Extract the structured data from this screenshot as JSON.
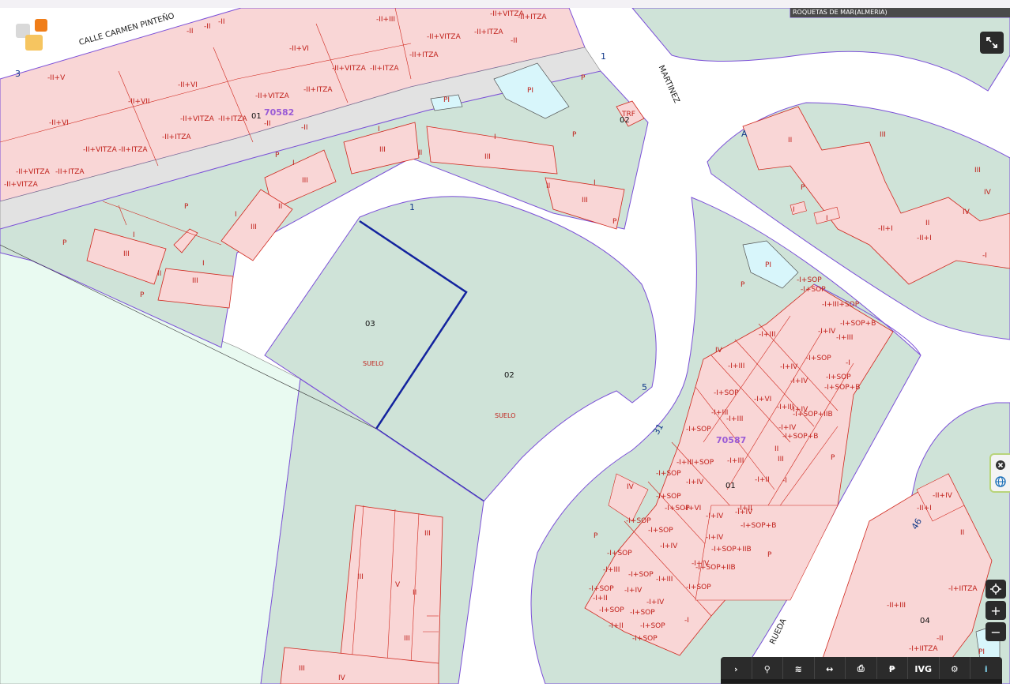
{
  "header": {
    "region_label": "ROQUETAS DE MAR(ALMERIA)"
  },
  "colors": {
    "built_fill": "#f9d6d6",
    "built_stroke": "#d0261c",
    "green_fill": "#cfe3d8",
    "street_fill": "#ffffff",
    "block_border": "#7b4fd8",
    "selected_parcel": "#13239e",
    "pool_fill": "#d8f6fb",
    "sidewalk_fill": "#e2e2e2",
    "pale_green": "#e9faf1"
  },
  "streets": {
    "carmen_pinteno": "CALLE CARMEN PINTEÑO",
    "martinez": "MARTINEZ",
    "rueda": "RUEDA"
  },
  "blocks": {
    "north": "70582",
    "east": "70587"
  },
  "plots": {
    "p03": {
      "number": "03",
      "use": "SUELO"
    },
    "p02": {
      "number": "02",
      "use": "SUELO"
    },
    "north_01": "01",
    "north_02": "02",
    "east_01": "01",
    "east_04": "04"
  },
  "labels": {
    "trf": "TRF",
    "pool": "PI",
    "patio": "P",
    "floor_I": "I",
    "floor_II": "II",
    "floor_III": "III",
    "floor_IV": "IV",
    "floor_V": "V",
    "f_mii": "-II",
    "f_miii": "-II+III",
    "f_miiv": "-II+V",
    "f_mivi": "-II+VI",
    "f_mivii": "-II+VII",
    "f_itza": "-II+ITZA",
    "f_ivitza": "-II+VITZA",
    "f_sop": "-I+SOP",
    "f_iiisop": "-I+III+SOP",
    "f_iv": "-I+IV",
    "f_vi": "-I+VI",
    "f_ii": "-I+II",
    "f_iii": "-I+III",
    "f_sopb": "-I+SOP+B",
    "f_sopiib": "-I+SOP+IIB",
    "f_iitza": "-I+IITZA",
    "f_m1": "-I",
    "f_iiiv": "-II+IV",
    "f_iiii": "-II+I",
    "f_iiii2": "-II+III"
  },
  "numbers": {
    "n1": "1",
    "n3": "3",
    "n5": "5",
    "n31": "31",
    "n46": "46",
    "nA": "A"
  },
  "toolbar": {
    "items": [
      {
        "icon": "chevron-right-icon",
        "glyph": "›"
      },
      {
        "icon": "search-icon",
        "glyph": "⚲"
      },
      {
        "icon": "layers-icon",
        "glyph": "≋"
      },
      {
        "icon": "measure-icon",
        "glyph": "↔"
      },
      {
        "icon": "print-icon",
        "glyph": "⎙"
      },
      {
        "icon": "parcel-icon",
        "glyph": "₱"
      },
      {
        "icon": "ivg",
        "glyph": "IVG"
      },
      {
        "icon": "bike-icon",
        "glyph": "⚙"
      },
      {
        "icon": "info-icon",
        "glyph": "i"
      }
    ]
  },
  "zoom": {
    "plus": "+",
    "minus": "−"
  },
  "side_panel": {
    "close": "close-icon",
    "layers": "globe-icon"
  }
}
